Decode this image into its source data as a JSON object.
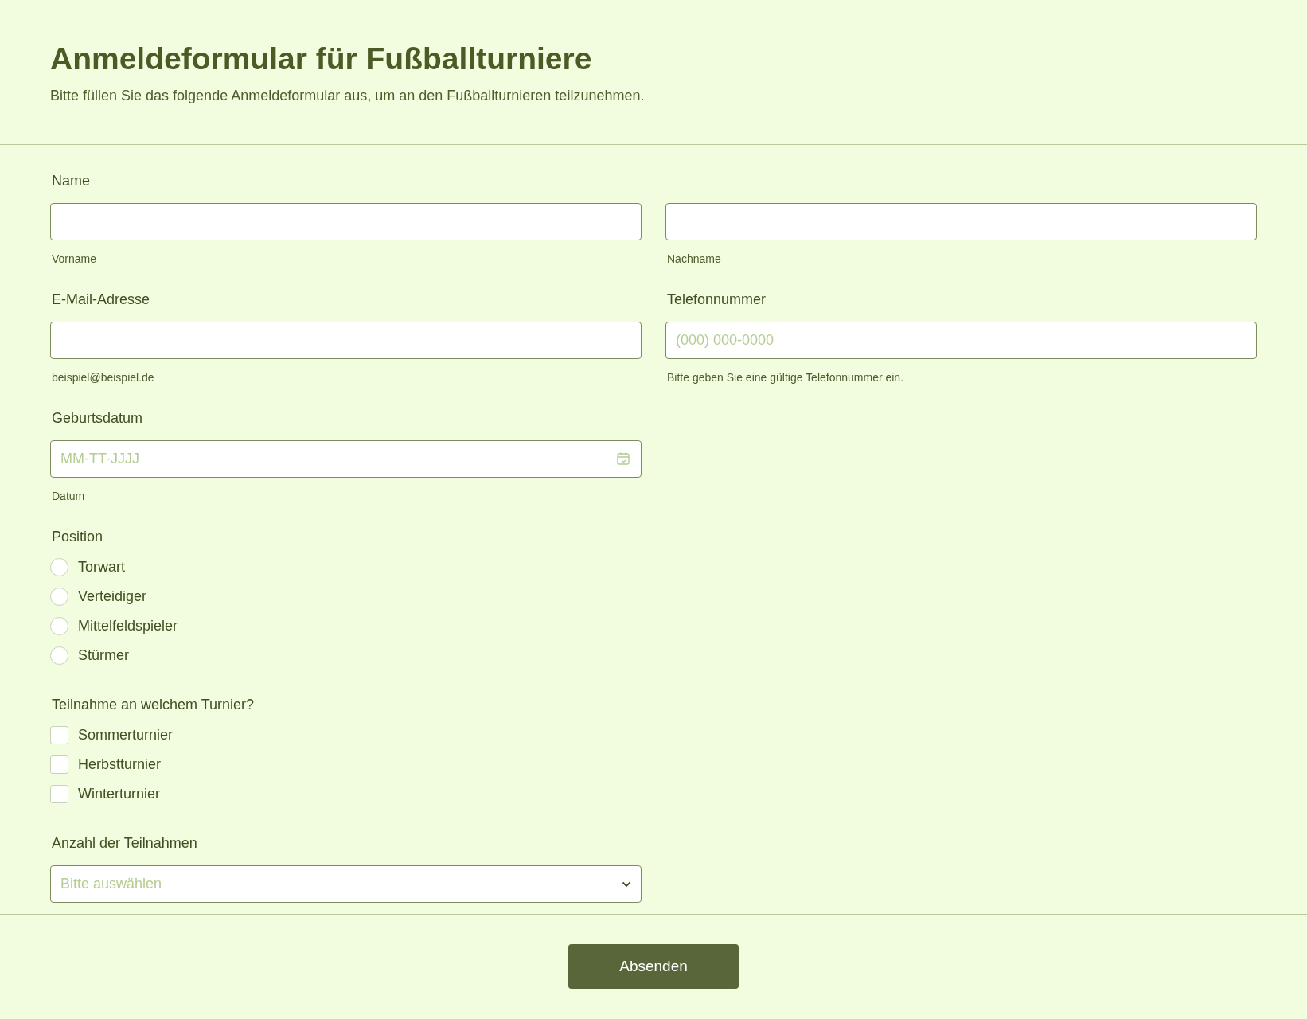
{
  "header": {
    "title": "Anmeldeformular für Fußballturniere",
    "description": "Bitte füllen Sie das folgende Anmeldeformular aus, um an den Fußballturnieren teilzunehmen."
  },
  "rows": [
    {
      "fields": [
        {
          "kind": "text",
          "label": "Name",
          "sublabel": "Vorname"
        },
        {
          "kind": "text",
          "sublabel": "Nachname"
        }
      ]
    },
    {
      "fields": [
        {
          "kind": "text",
          "label": "E-Mail-Adresse",
          "sublabel": "beispiel@beispiel.de"
        },
        {
          "kind": "text",
          "label": "Telefonnummer",
          "placeholder": "(000) 000-0000",
          "sublabel": "Bitte geben Sie eine gültige Telefonnummer ein."
        }
      ]
    },
    {
      "fields": [
        {
          "kind": "date",
          "label": "Geburtsdatum",
          "placeholder": "MM-TT-JJJJ",
          "sublabel": "Datum"
        }
      ]
    },
    {
      "fields": [
        {
          "kind": "radio",
          "label": "Position",
          "options": [
            {
              "label": "Torwart",
              "selected": false
            },
            {
              "label": "Verteidiger",
              "selected": false
            },
            {
              "label": "Mittelfeldspieler",
              "selected": false
            },
            {
              "label": "Stürmer",
              "selected": false
            }
          ]
        }
      ]
    },
    {
      "fields": [
        {
          "kind": "checkbox",
          "label": "Teilnahme an welchem Turnier?",
          "options": [
            {
              "label": "Sommerturnier",
              "checked": false
            },
            {
              "label": "Herbstturnier",
              "checked": false
            },
            {
              "label": "Winterturnier",
              "checked": false
            }
          ]
        }
      ]
    },
    {
      "fields": [
        {
          "kind": "select",
          "label": "Anzahl der Teilnahmen",
          "placeholder": "Bitte auswählen"
        }
      ]
    }
  ],
  "submit": {
    "label": "Absenden"
  }
}
